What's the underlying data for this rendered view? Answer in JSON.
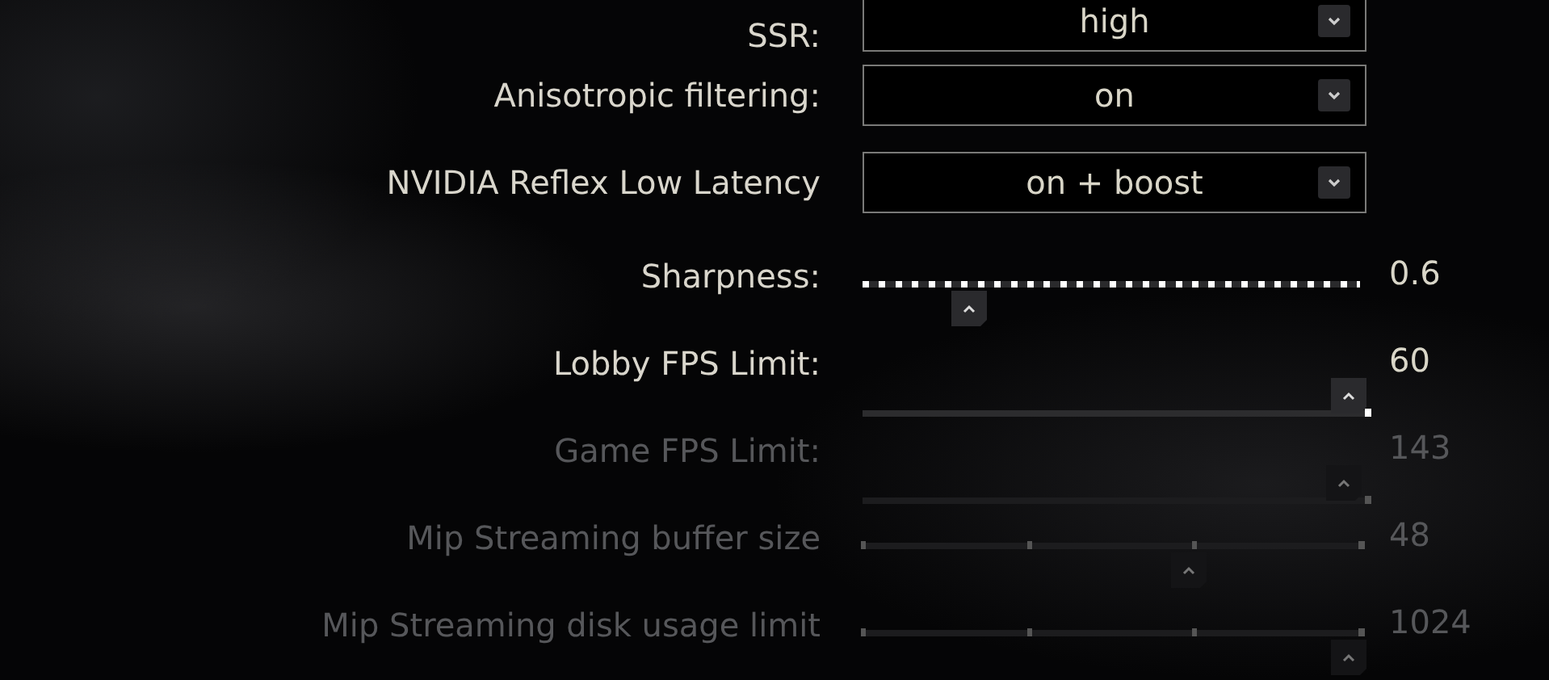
{
  "settings": [
    {
      "kind": "dropdown",
      "label": "SSR:",
      "value": "high",
      "disabled": false
    },
    {
      "kind": "dropdown",
      "label": "Anisotropic filtering:",
      "value": "on",
      "disabled": false
    },
    {
      "kind": "dropdown",
      "label": "NVIDIA Reflex Low Latency",
      "value": "on + boost",
      "disabled": false
    },
    {
      "kind": "dotted-slider",
      "label": "Sharpness:",
      "level": 0.19,
      "reading": "0.6",
      "disabled": false
    },
    {
      "kind": "slider",
      "label": "Lobby FPS Limit:",
      "level": 1.0,
      "reading": "60",
      "disabled": false
    },
    {
      "kind": "slider",
      "label": "Game FPS Limit:",
      "level": 0.99,
      "reading": "143",
      "disabled": true
    },
    {
      "kind": "stepped-slider",
      "label": "Mip Streaming buffer size",
      "level": 0.66,
      "reading": "48",
      "disabled": true
    },
    {
      "kind": "stepped-slider",
      "label": "Mip Streaming disk usage limit",
      "level": 1.0,
      "reading": "1024",
      "disabled": true
    }
  ]
}
